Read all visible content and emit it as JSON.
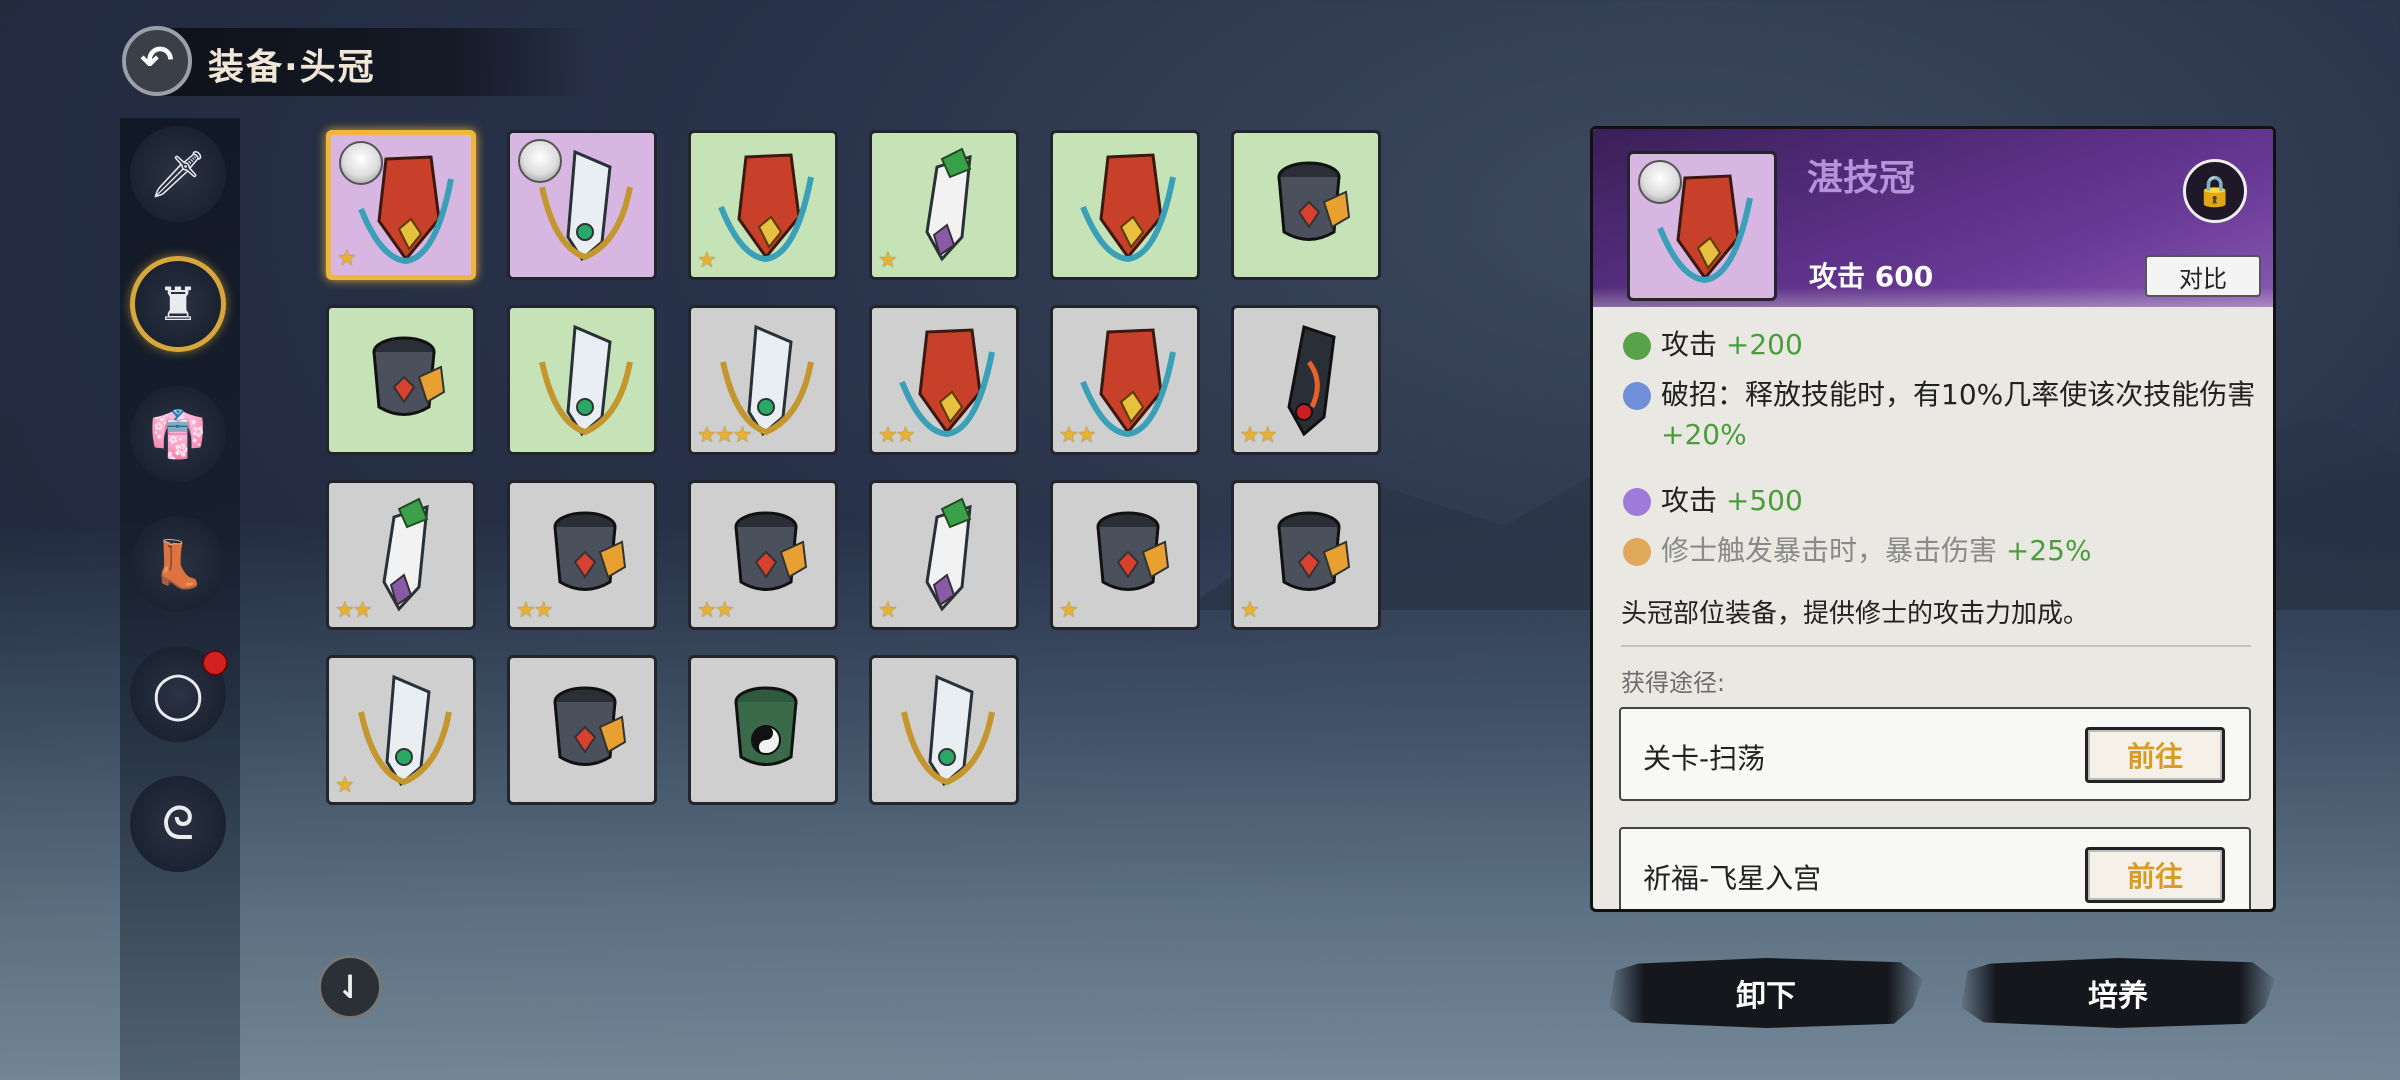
{
  "header": {
    "title": "装备·头冠"
  },
  "sidebar": {
    "items": [
      {
        "name": "weapon",
        "icon": "sword-icon",
        "glyph": "🗡",
        "active": false
      },
      {
        "name": "crown",
        "icon": "crown-icon",
        "glyph": "♜",
        "active": true
      },
      {
        "name": "robe",
        "icon": "robe-icon",
        "glyph": "👘",
        "active": false
      },
      {
        "name": "boots",
        "icon": "boots-icon",
        "glyph": "👢",
        "active": false
      },
      {
        "name": "ring",
        "icon": "ring-icon",
        "glyph": "◯",
        "active": false,
        "badge": true
      },
      {
        "name": "pendant",
        "icon": "pendant-icon",
        "glyph": "ᘓ",
        "active": false
      }
    ]
  },
  "grid": {
    "items": [
      {
        "rarity": "purple",
        "art": "red-crown",
        "stars": "★",
        "avatar": true,
        "selected": true
      },
      {
        "rarity": "purple",
        "art": "silver-crown",
        "stars": "",
        "avatar": true
      },
      {
        "rarity": "green",
        "art": "red-crown",
        "stars": "★"
      },
      {
        "rarity": "green",
        "art": "green-crown",
        "stars": "★"
      },
      {
        "rarity": "green",
        "art": "red-crown",
        "stars": ""
      },
      {
        "rarity": "green",
        "art": "black-crown",
        "stars": ""
      },
      {
        "rarity": "green",
        "art": "black-crown",
        "stars": ""
      },
      {
        "rarity": "green",
        "art": "silver-crown",
        "stars": ""
      },
      {
        "rarity": "gray",
        "art": "silver-crown",
        "stars": "★★★"
      },
      {
        "rarity": "gray",
        "art": "red-crown",
        "stars": "★★"
      },
      {
        "rarity": "gray",
        "art": "red-crown",
        "stars": "★★"
      },
      {
        "rarity": "gray",
        "art": "dark-crown",
        "stars": "★★"
      },
      {
        "rarity": "gray",
        "art": "green-crown",
        "stars": "★★"
      },
      {
        "rarity": "gray",
        "art": "black-crown",
        "stars": "★★"
      },
      {
        "rarity": "gray",
        "art": "black-crown",
        "stars": "★★"
      },
      {
        "rarity": "gray",
        "art": "green-crown",
        "stars": "★"
      },
      {
        "rarity": "gray",
        "art": "black-crown",
        "stars": "★"
      },
      {
        "rarity": "gray",
        "art": "black-crown",
        "stars": "★"
      },
      {
        "rarity": "gray",
        "art": "silver-crown",
        "stars": "★"
      },
      {
        "rarity": "gray",
        "art": "black-crown",
        "stars": ""
      },
      {
        "rarity": "gray",
        "art": "yinyang-crown",
        "stars": ""
      },
      {
        "rarity": "gray",
        "art": "silver-crown",
        "stars": ""
      }
    ]
  },
  "detail": {
    "name": "湛技冠",
    "attack_label": "攻击 600",
    "compare_label": "对比",
    "lock_icon": "lock-icon",
    "stats": [
      {
        "color": "#5aa24a",
        "text": "攻击 ",
        "bonus": "+200",
        "disabled": false
      },
      {
        "color": "#6f8fd8",
        "text": "破招：释放技能时，有10%几率使该次技能伤害 ",
        "bonus": "+20%",
        "disabled": false
      },
      {
        "color": "#a07ad8",
        "text": "攻击 ",
        "bonus": "+500",
        "disabled": false
      },
      {
        "color": "#e0a85a",
        "text": "修士触发暴击时，暴击伤害 ",
        "bonus": "+25%",
        "disabled": true
      }
    ],
    "description": "头冠部位装备，提供修士的攻击力加成。",
    "source_title": "获得途径:",
    "sources": [
      {
        "label": "关卡-扫荡",
        "button": "前往"
      },
      {
        "label": "祈福-飞星入宫",
        "button": "前往"
      }
    ]
  },
  "actions": {
    "unequip": "卸下",
    "cultivate": "培养"
  },
  "sort_icon": "sort-icon"
}
